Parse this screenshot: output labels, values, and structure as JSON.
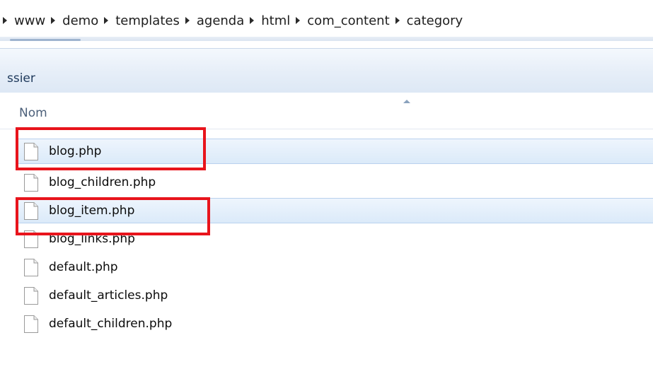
{
  "breadcrumb": {
    "items": [
      "www",
      "demo",
      "templates",
      "agenda",
      "html",
      "com_content",
      "category"
    ]
  },
  "toolbar": {
    "label": "ssier"
  },
  "column_header": {
    "name_label": "Nom"
  },
  "files": [
    {
      "name": "blog.php",
      "selected": true,
      "highlighted": true
    },
    {
      "name": "blog_children.php",
      "selected": false,
      "highlighted": false
    },
    {
      "name": "blog_item.php",
      "selected": true,
      "highlighted": true
    },
    {
      "name": "blog_links.php",
      "selected": false,
      "highlighted": false
    },
    {
      "name": "default.php",
      "selected": false,
      "highlighted": false
    },
    {
      "name": "default_articles.php",
      "selected": false,
      "highlighted": false
    },
    {
      "name": "default_children.php",
      "selected": false,
      "highlighted": false
    }
  ],
  "colors": {
    "highlight_border": "#e8141c",
    "selection_background": "#dbeaf9",
    "header_text": "#4c607a"
  },
  "icons": {
    "breadcrumb_separator": "triangle-right-icon",
    "file": "document-icon",
    "sort": "sort-ascending-icon"
  }
}
